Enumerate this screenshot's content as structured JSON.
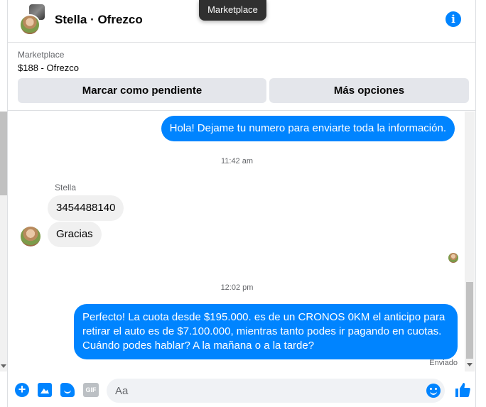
{
  "header": {
    "title": "Stella · Ofrezco",
    "tooltip": "Marketplace",
    "info_icon": "info-icon"
  },
  "marketplace": {
    "label": "Marketplace",
    "listing": "$188 - Ofrezco",
    "buttons": {
      "pending": "Marcar como pendiente",
      "more": "Más opciones"
    }
  },
  "messages": [
    {
      "from": "me",
      "text": "Hola! Dejame tu numero  para enviarte toda la información."
    },
    {
      "type": "timestamp",
      "text": "11:42 am"
    },
    {
      "from": "Stella",
      "sender_label": "Stella",
      "text": "3454488140"
    },
    {
      "from": "Stella",
      "text": "Gracias"
    },
    {
      "type": "timestamp",
      "text": "12:02 pm"
    },
    {
      "from": "me",
      "text": "Perfecto! La cuota desde $195.000. es de un CRONOS 0KM el anticipo para retirar el auto es de $7.100.000, mientras tanto podes ir pagando en cuotas. Cuándo podes hablar? A la mañana o a la tarde?"
    }
  ],
  "status": {
    "sent": "Enviado"
  },
  "composer": {
    "placeholder": "Aa",
    "icons": [
      "plus-icon",
      "photo-icon",
      "sticker-icon",
      "gif-icon",
      "emoji-icon",
      "like-icon"
    ],
    "gif_label": "GIF"
  },
  "colors": {
    "accent": "#0084ff",
    "incoming": "#f0f0f0",
    "muted": "#65676b"
  }
}
